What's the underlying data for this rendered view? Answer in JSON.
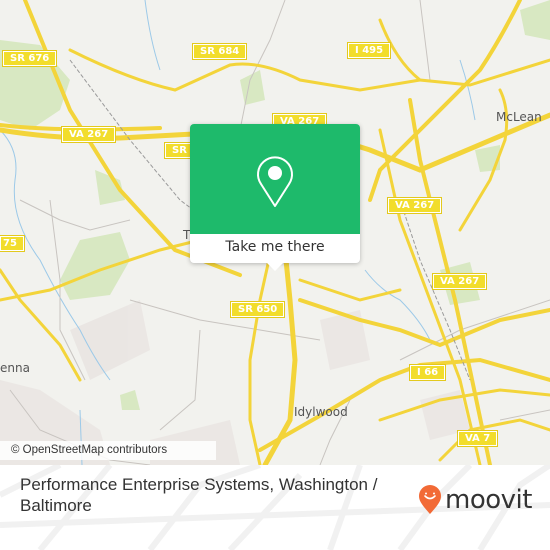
{
  "map": {
    "road_shields": [
      {
        "label": "SR 676"
      },
      {
        "label": "SR 684"
      },
      {
        "label": "I 495"
      },
      {
        "label": "VA 267"
      },
      {
        "label": "VA 267"
      },
      {
        "label": "SR"
      },
      {
        "label": "VA 267"
      },
      {
        "label": "VA 267"
      },
      {
        "label": "75"
      },
      {
        "label": "SR 650"
      },
      {
        "label": "I 66"
      },
      {
        "label": "VA 7"
      }
    ],
    "places": [
      {
        "label": "McLean"
      },
      {
        "label": "Idylwood"
      },
      {
        "label": "enna"
      },
      {
        "label": "T"
      }
    ],
    "attribution": "© OpenStreetMap contributors"
  },
  "popup": {
    "icon": "map-pin-icon",
    "button_label": "Take me there",
    "color": "#1eba6b"
  },
  "footer": {
    "title": "Performance Enterprise Systems, Washington / Baltimore",
    "logo_text": "moovit",
    "logo_icon": "moovit-pin-icon",
    "logo_color": "#f26a36"
  }
}
